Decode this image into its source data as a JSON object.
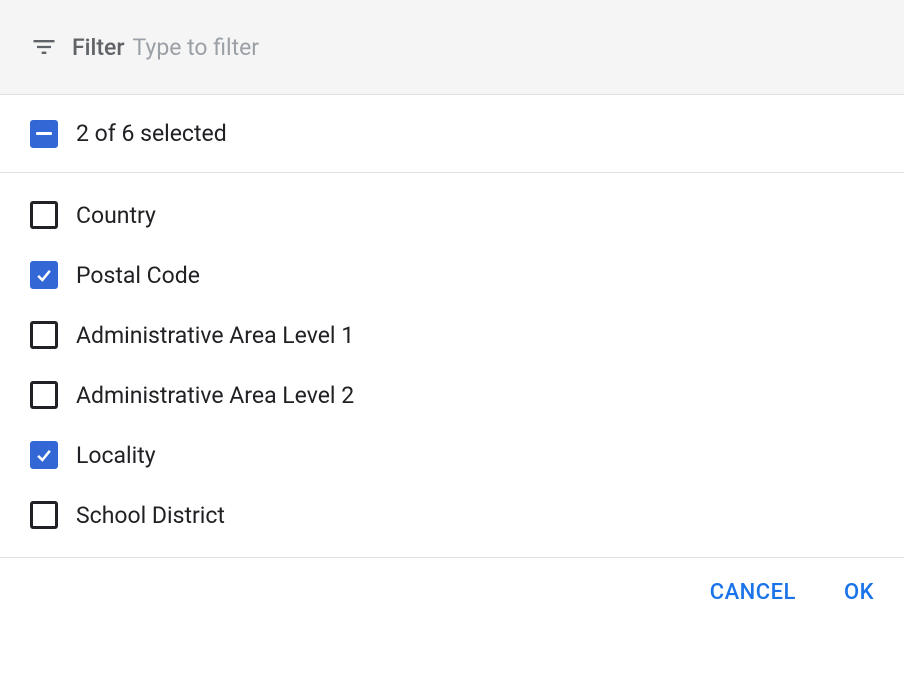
{
  "filter": {
    "label": "Filter",
    "placeholder": "Type to filter"
  },
  "summary": {
    "text": "2 of 6 selected"
  },
  "options": [
    {
      "label": "Country",
      "checked": false
    },
    {
      "label": "Postal Code",
      "checked": true
    },
    {
      "label": "Administrative Area Level 1",
      "checked": false
    },
    {
      "label": "Administrative Area Level 2",
      "checked": false
    },
    {
      "label": "Locality",
      "checked": true
    },
    {
      "label": "School District",
      "checked": false
    }
  ],
  "actions": {
    "cancel": "CANCEL",
    "ok": "OK"
  }
}
